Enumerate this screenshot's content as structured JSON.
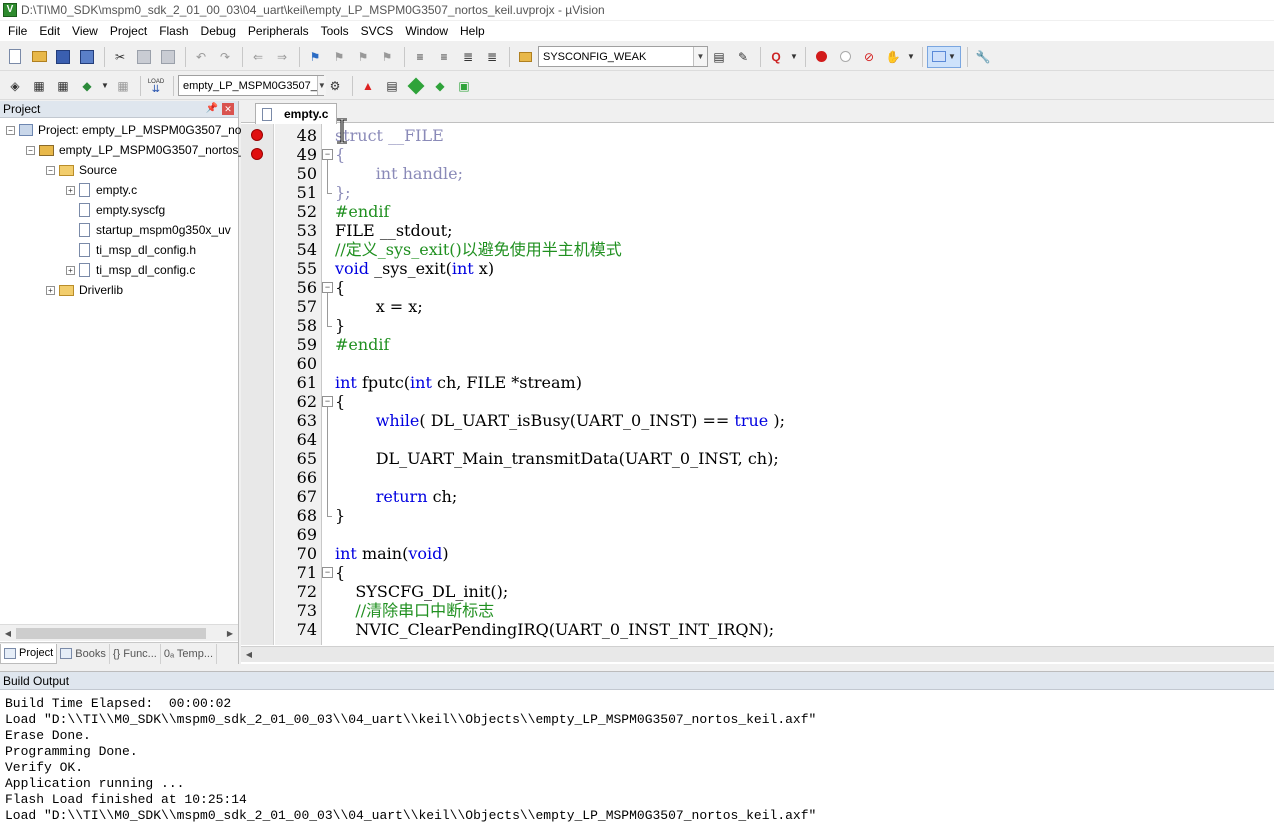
{
  "window": {
    "title": "D:\\TI\\M0_SDK\\mspm0_sdk_2_01_00_03\\04_uart\\keil\\empty_LP_MSPM0G3507_nortos_keil.uvprojx - µVision"
  },
  "menu": [
    "File",
    "Edit",
    "View",
    "Project",
    "Flash",
    "Debug",
    "Peripherals",
    "Tools",
    "SVCS",
    "Window",
    "Help"
  ],
  "toolbar1": {
    "icons": [
      "new-file",
      "open-folder",
      "save",
      "save-all",
      "cut",
      "copy",
      "paste",
      "undo",
      "redo",
      "back",
      "forward",
      "bookmark",
      "bookmark-prev",
      "bookmark-next",
      "bookmark-clear",
      "indent",
      "unindent",
      "comment",
      "uncomment"
    ],
    "find_combo_value": "SYSCONFIG_WEAK"
  },
  "toolbar2": {
    "target_combo_value": "empty_LP_MSPM0G3507_",
    "load_label": "LOAD"
  },
  "project_panel": {
    "title": "Project",
    "tree": [
      {
        "label": "Project: empty_LP_MSPM0G3507_no",
        "level": 0,
        "expanded": true,
        "kind": "project"
      },
      {
        "label": "empty_LP_MSPM0G3507_nortos_",
        "level": 1,
        "expanded": true,
        "kind": "target"
      },
      {
        "label": "Source",
        "level": 2,
        "expanded": true,
        "kind": "folder"
      },
      {
        "label": "empty.c",
        "level": 3,
        "expanded": false,
        "kind": "file",
        "has_toggle": true
      },
      {
        "label": "empty.syscfg",
        "level": 3,
        "kind": "file",
        "has_toggle": false
      },
      {
        "label": "startup_mspm0g350x_uv",
        "level": 3,
        "kind": "file",
        "has_toggle": false
      },
      {
        "label": "ti_msp_dl_config.h",
        "level": 3,
        "kind": "file",
        "has_toggle": false
      },
      {
        "label": "ti_msp_dl_config.c",
        "level": 3,
        "kind": "file",
        "has_toggle": true
      },
      {
        "label": "Driverlib",
        "level": 2,
        "expanded": false,
        "kind": "folder"
      }
    ],
    "tabs": [
      "Project",
      "Books",
      "{} Func...",
      "0ₐ Temp..."
    ]
  },
  "editor": {
    "active_tab": "empty.c",
    "breakpoint_lines": [
      48,
      49
    ],
    "lines": [
      {
        "n": "48",
        "text": "struct __FILE",
        "style": "dim"
      },
      {
        "n": "49",
        "text": "{",
        "style": "dim",
        "fold": "open"
      },
      {
        "n": "50",
        "text": "        int handle;",
        "style": "dim"
      },
      {
        "n": "51",
        "text": "};",
        "style": "dim"
      },
      {
        "n": "52",
        "text": "#endif",
        "style": "pp"
      },
      {
        "n": "53",
        "text": "FILE __stdout;",
        "style": "plain"
      },
      {
        "n": "54",
        "text": "//定义_sys_exit()以避免使用半主机模式",
        "style": "cm"
      },
      {
        "n": "55",
        "text": "void _sys_exit(int x)",
        "style": "mixed"
      },
      {
        "n": "56",
        "text": "{",
        "style": "plain",
        "fold": "open"
      },
      {
        "n": "57",
        "text": "        x = x;",
        "style": "plain"
      },
      {
        "n": "58",
        "text": "}",
        "style": "plain"
      },
      {
        "n": "59",
        "text": "#endif",
        "style": "pp"
      },
      {
        "n": "60",
        "text": "",
        "style": "plain"
      },
      {
        "n": "61",
        "text": "int fputc(int ch, FILE *stream)",
        "style": "mixed"
      },
      {
        "n": "62",
        "text": "{",
        "style": "plain",
        "fold": "open"
      },
      {
        "n": "63",
        "text": "        while( DL_UART_isBusy(UART_0_INST) == true );",
        "style": "mixed"
      },
      {
        "n": "64",
        "text": "",
        "style": "plain"
      },
      {
        "n": "65",
        "text": "        DL_UART_Main_transmitData(UART_0_INST, ch);",
        "style": "plain"
      },
      {
        "n": "66",
        "text": "",
        "style": "plain"
      },
      {
        "n": "67",
        "text": "        return ch;",
        "style": "mixed"
      },
      {
        "n": "68",
        "text": "}",
        "style": "plain"
      },
      {
        "n": "69",
        "text": "",
        "style": "plain"
      },
      {
        "n": "70",
        "text": "int main(void)",
        "style": "mixed"
      },
      {
        "n": "71",
        "text": "{",
        "style": "plain",
        "fold": "open"
      },
      {
        "n": "72",
        "text": "    SYSCFG_DL_init();",
        "style": "plain"
      },
      {
        "n": "73",
        "text": "    //清除串口中断标志",
        "style": "cm"
      },
      {
        "n": "74",
        "text": "    NVIC_ClearPendingIRQ(UART_0_INST_INT_IRQN);",
        "style": "plain"
      }
    ]
  },
  "build_output": {
    "title": "Build Output",
    "lines": [
      "Build Time Elapsed:  00:00:02",
      "Load \"D:\\\\TI\\\\M0_SDK\\\\mspm0_sdk_2_01_00_03\\\\04_uart\\\\keil\\\\Objects\\\\empty_LP_MSPM0G3507_nortos_keil.axf\"",
      "Erase Done.",
      "Programming Done.",
      "Verify OK.",
      "Application running ...",
      "Flash Load finished at 10:25:14",
      "Load \"D:\\\\TI\\\\M0_SDK\\\\mspm0_sdk_2_01_00_03\\\\04_uart\\\\keil\\\\Objects\\\\empty_LP_MSPM0G3507_nortos_keil.axf\""
    ]
  }
}
